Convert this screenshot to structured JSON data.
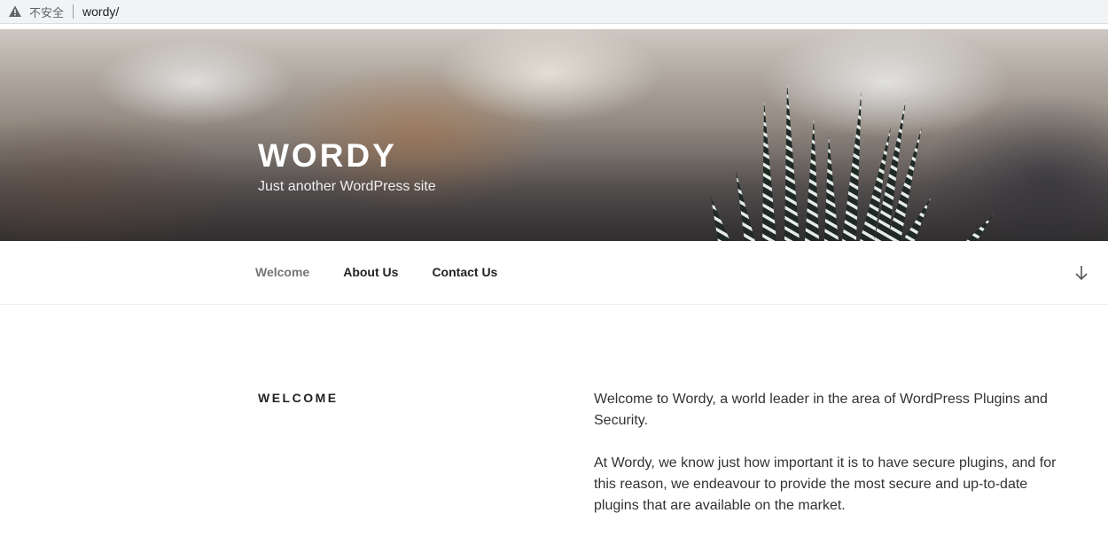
{
  "browser": {
    "security_label": "不安全",
    "url": "wordy/"
  },
  "site": {
    "title": "WORDY",
    "description": "Just another WordPress site"
  },
  "nav": {
    "items": [
      {
        "label": "Welcome",
        "current": true
      },
      {
        "label": "About Us",
        "current": false
      },
      {
        "label": "Contact Us",
        "current": false
      }
    ],
    "scroll_icon": "arrow-down-icon"
  },
  "content": {
    "heading": "WELCOME",
    "paragraphs": [
      "Welcome to Wordy, a world leader in the area of WordPress Plugins and Security.",
      "At Wordy, we know just how important it is to have secure plugins, and for this reason, we endeavour to provide the most secure and up-to-date plugins that are available on the market."
    ]
  },
  "colors": {
    "nav_current": "#767676",
    "text_dark": "#222222",
    "header_text": "#ffffff"
  }
}
